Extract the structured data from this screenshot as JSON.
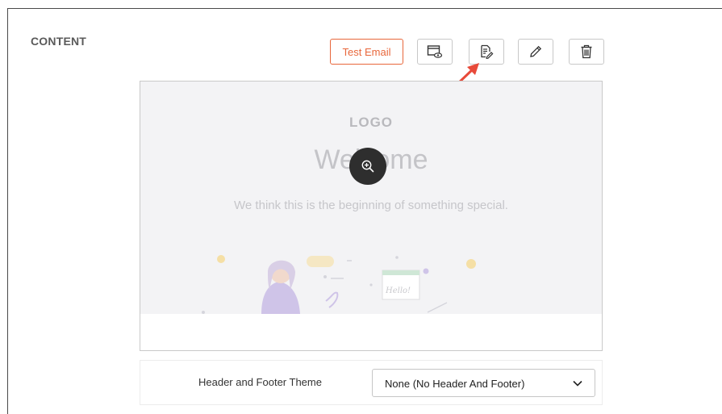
{
  "section": {
    "title": "CONTENT"
  },
  "toolbar": {
    "test_email_label": "Test Email",
    "buttons": [
      {
        "name": "preview-icon"
      },
      {
        "name": "edit-template-icon"
      },
      {
        "name": "pencil-icon"
      },
      {
        "name": "trash-icon"
      }
    ]
  },
  "preview": {
    "logo": "LOGO",
    "headline": "Welcome",
    "tagline": "We think this is the beginning of something special.",
    "zoom_icon": "zoom-in-icon",
    "illustration_text": "Hello!"
  },
  "theme": {
    "label": "Header and Footer Theme",
    "selected": "None (No Header And Footer)"
  },
  "colors": {
    "accent": "#e8673b",
    "annotation_arrow": "#e84a3a"
  }
}
